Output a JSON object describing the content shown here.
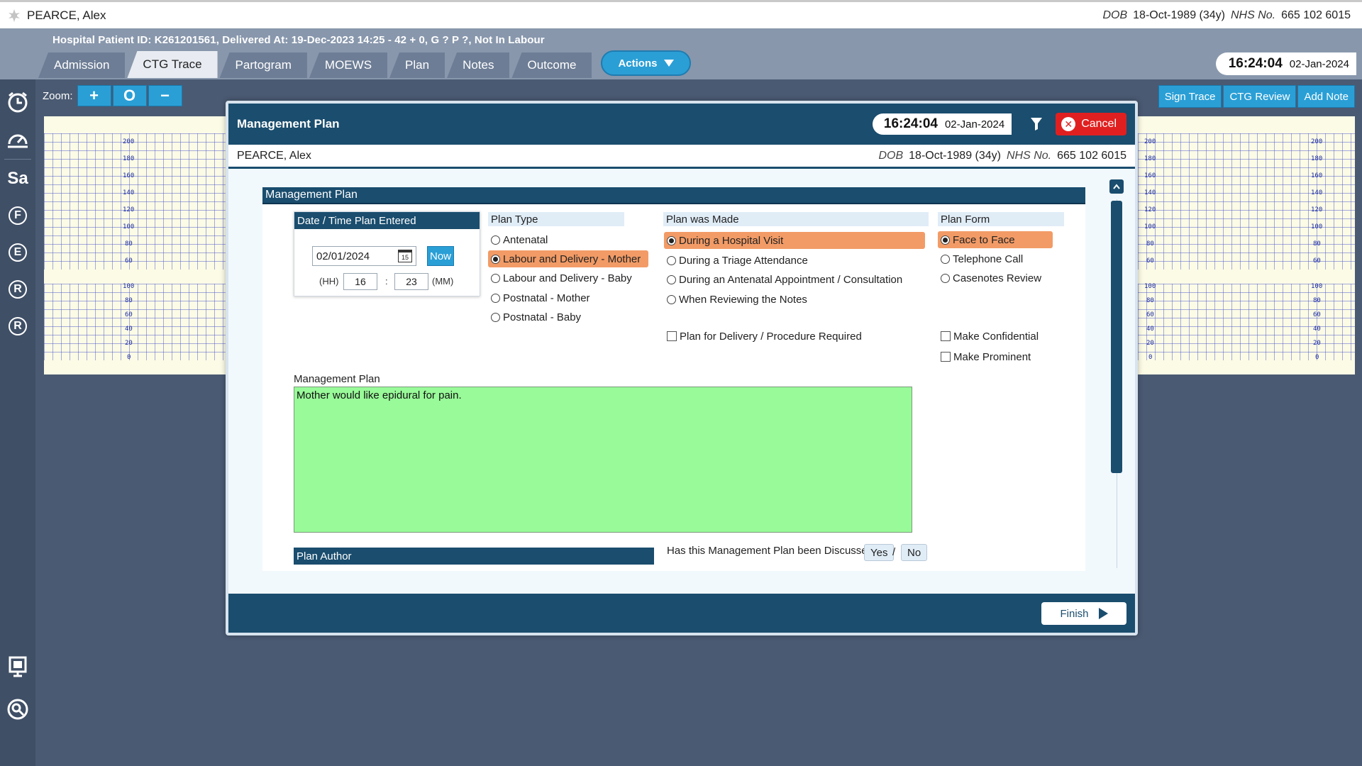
{
  "topbar": {
    "patient_name": "PEARCE, Alex",
    "dob_label": "DOB",
    "dob_value": "18-Oct-1989 (34y)",
    "nhs_label": "NHS No.",
    "nhs_value": "665 102 6015"
  },
  "header": {
    "info": "Hospital Patient ID: K261201561, Delivered At: 19-Dec-2023 14:25 - 42 + 0, G ? P ?,   Not In Labour",
    "tabs": [
      "Admission",
      "CTG Trace",
      "Partogram",
      "MOEWS",
      "Plan",
      "Notes",
      "Outcome"
    ],
    "active_tab": "CTG Trace",
    "actions_label": "Actions",
    "time": "16:24:04",
    "date": "02-Jan-2024"
  },
  "sidebar": {
    "letters": [
      "Sa",
      "F",
      "E",
      "R",
      "R"
    ]
  },
  "toolbar": {
    "zoom_label": "Zoom:",
    "zoom_in": "+",
    "zoom_reset": "O",
    "zoom_out": "−",
    "sign_trace": "Sign Trace",
    "ctg_review": "CTG Review",
    "add_note": "Add Note"
  },
  "ctg": {
    "fhr_ticks": [
      "200",
      "180",
      "160",
      "140",
      "120",
      "100",
      "80",
      "60"
    ],
    "toco_ticks": [
      "100",
      "80",
      "60",
      "40",
      "20",
      "0"
    ]
  },
  "modal": {
    "title": "Management Plan",
    "time": "16:24:04",
    "date": "02-Jan-2024",
    "cancel_label": "Cancel",
    "patient_name": "PEARCE, Alex",
    "dob_label": "DOB",
    "dob_value": "18-Oct-1989 (34y)",
    "nhs_label": "NHS No.",
    "nhs_value": "665 102 6015",
    "panel_title": "Management Plan",
    "datetime": {
      "heading": "Date / Time Plan Entered",
      "date_value": "02/01/2024",
      "calendar_day": "15",
      "now_label": "Now",
      "hh_label": "(HH)",
      "hour": "16",
      "colon": ":",
      "minute": "23",
      "mm_label": "(MM)"
    },
    "plan_type": {
      "heading": "Plan Type",
      "options": [
        "Antenatal",
        "Labour and Delivery - Mother",
        "Labour and Delivery - Baby",
        "Postnatal - Mother",
        "Postnatal - Baby"
      ],
      "selected": "Labour and Delivery - Mother"
    },
    "plan_made": {
      "heading": "Plan was Made",
      "options": [
        "During a Hospital Visit",
        "During a Triage Attendance",
        "During an Antenatal Appointment / Consultation",
        "When Reviewing the Notes"
      ],
      "selected": "During a Hospital Visit",
      "delivery_checkbox": "Plan for Delivery / Procedure Required"
    },
    "plan_form": {
      "heading": "Plan Form",
      "options": [
        "Face to Face",
        "Telephone Call",
        "Casenotes Review"
      ],
      "selected": "Face to Face",
      "confidential": "Make Confidential",
      "prominent": "Make Prominent"
    },
    "plan_label": "Management Plan",
    "plan_text": "Mother would like epidural for pain.",
    "author_heading": "Plan Author",
    "discussed_question": "Has this Management Plan been Discussed",
    "yes_label": "Yes",
    "slash": "/",
    "no_label": "No",
    "finish_label": "Finish"
  }
}
